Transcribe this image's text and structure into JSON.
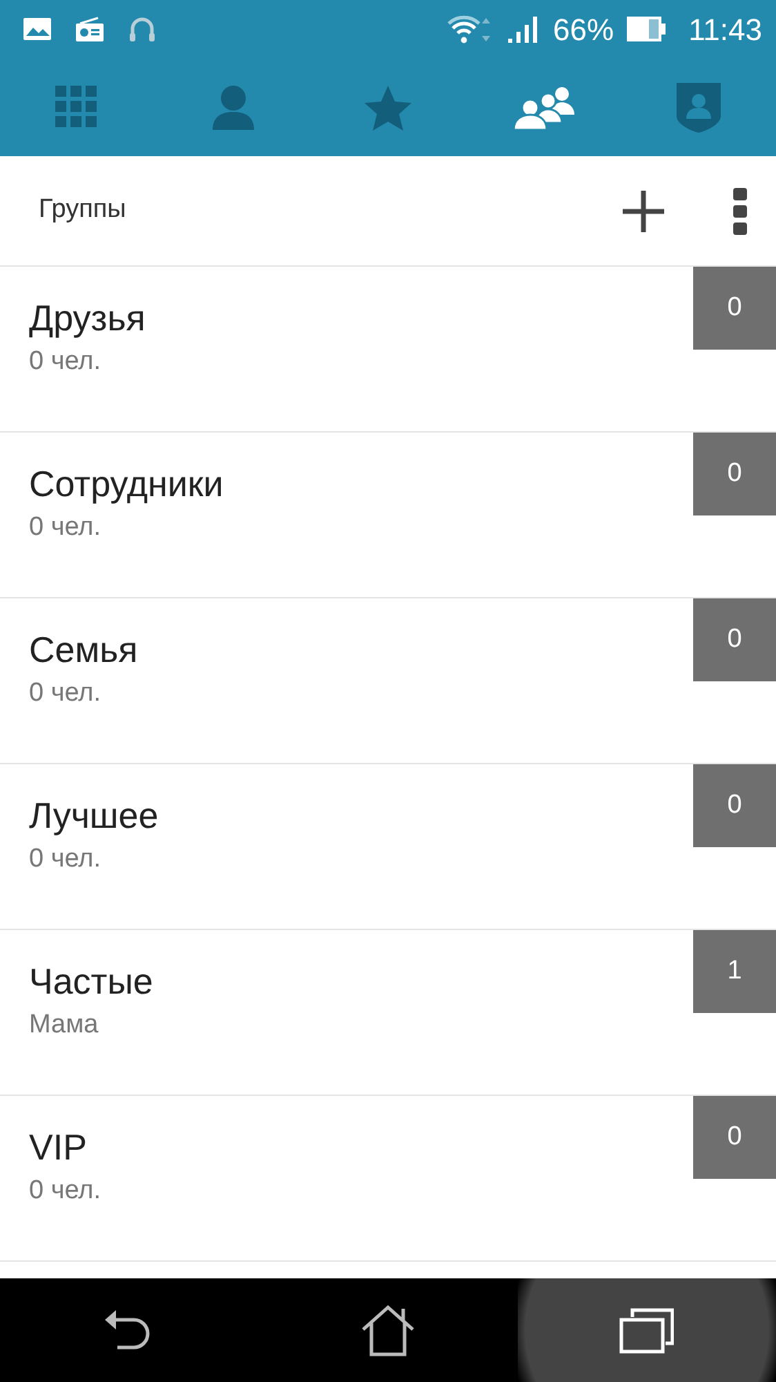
{
  "status_bar": {
    "battery": "66%",
    "time": "11:43"
  },
  "tabs": [
    {
      "kind": "dialpad",
      "selected": false
    },
    {
      "kind": "contacts",
      "selected": false
    },
    {
      "kind": "favorites",
      "selected": false
    },
    {
      "kind": "groups",
      "selected": true
    },
    {
      "kind": "profile",
      "selected": false
    }
  ],
  "header": {
    "title": "Группы"
  },
  "groups": [
    {
      "name": "Друзья",
      "subtitle": "0 чел.",
      "count": "0"
    },
    {
      "name": "Сотрудники",
      "subtitle": "0 чел.",
      "count": "0"
    },
    {
      "name": "Семья",
      "subtitle": "0 чел.",
      "count": "0"
    },
    {
      "name": "Лучшее",
      "subtitle": "0 чел.",
      "count": "0"
    },
    {
      "name": "Частые",
      "subtitle": "Мама",
      "count": "1"
    },
    {
      "name": "VIP",
      "subtitle": "0 чел.",
      "count": "0"
    }
  ]
}
